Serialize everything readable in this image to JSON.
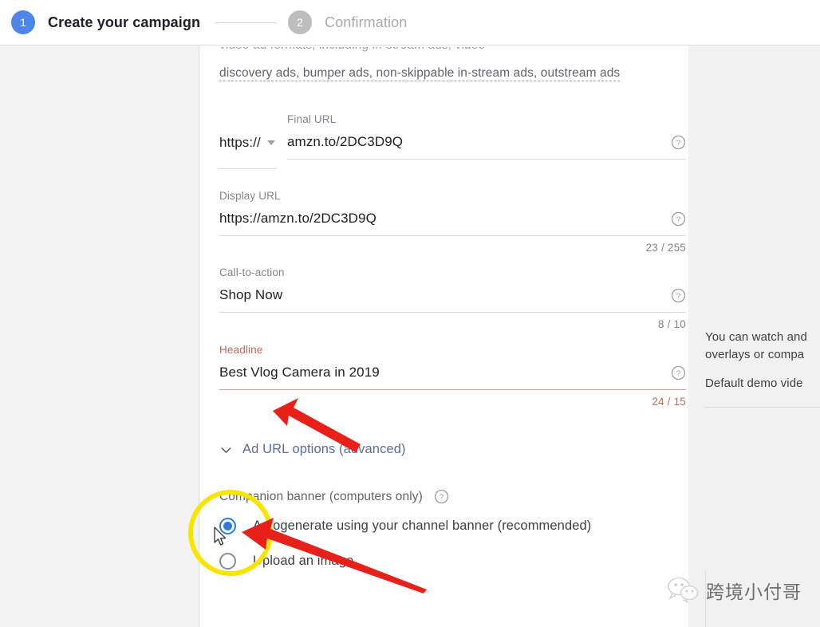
{
  "stepper": {
    "step1": {
      "number": "1",
      "label": "Create your campaign"
    },
    "step2": {
      "number": "2",
      "label": "Confirmation"
    }
  },
  "ad_formats": {
    "visible_line": "discovery ads, bumper ads, non-skippable in-stream ads, outstream ads",
    "clipped_line_above": "video ad formats, including in-stream ads, video"
  },
  "form": {
    "final_url": {
      "label": "Final URL",
      "protocol": "https://",
      "value": "amzn.to/2DC3D9Q",
      "help": "help-icon"
    },
    "display_url": {
      "label": "Display URL",
      "value": "https://amzn.to/2DC3D9Q",
      "counter": "23 / 255"
    },
    "call_to_action": {
      "label": "Call-to-action",
      "value": "Shop Now",
      "counter": "8 / 10"
    },
    "headline": {
      "label": "Headline",
      "value": "Best Vlog Camera in 2019",
      "counter": "24 / 15",
      "error_color": "#c06a5c"
    },
    "ad_url_options": {
      "label": "Ad URL options (advanced)",
      "link_color": "#5a6b9e"
    }
  },
  "companion_banner": {
    "title": "Companion banner (computers only)",
    "options": [
      {
        "label": "Autogenerate using your channel banner (recommended)",
        "selected": true
      },
      {
        "label": "Upload an image",
        "selected": false
      }
    ],
    "selected_color": "#2d7ae5"
  },
  "right_panel": {
    "line1": "You can watch and",
    "line2": "overlays or compa",
    "line3": "Default demo vide"
  },
  "watermark": {
    "text": "跨境小付哥",
    "icon": "wechat-icon"
  },
  "colors": {
    "accent_blue": "#4e85e8",
    "inactive_gray": "#bdbdbd",
    "annotation_yellow": "#f9e400",
    "annotation_red": "#e8201a"
  }
}
